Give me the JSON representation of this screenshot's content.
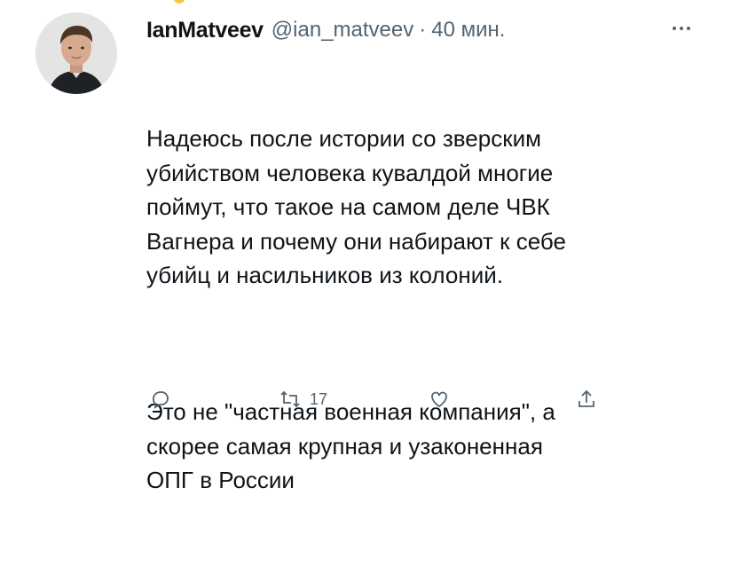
{
  "tweet": {
    "display_name": "IanMatveev",
    "handle": "@ian_matveev",
    "separator": "·",
    "time": "40 мин.",
    "paragraphs": [
      "Надеюсь после истории со зверским\nубийством человека кувалдой многие\nпоймут, что такое на самом деле ЧВК\nВагнера и почему они набирают к себе\nубийц и насильников из колоний.",
      "Это не \"частная военная компания\", а\nскорее самая крупная и узаконенная\nОПГ в России"
    ],
    "actions": [
      {
        "icon": "reply-icon"
      },
      {
        "icon": "retweet-icon",
        "count": "17"
      },
      {
        "icon": "like-icon"
      },
      {
        "icon": "share-icon"
      }
    ]
  },
  "colors": {
    "text_primary": "#0f1419",
    "text_secondary": "#536471",
    "background": "#ffffff"
  }
}
